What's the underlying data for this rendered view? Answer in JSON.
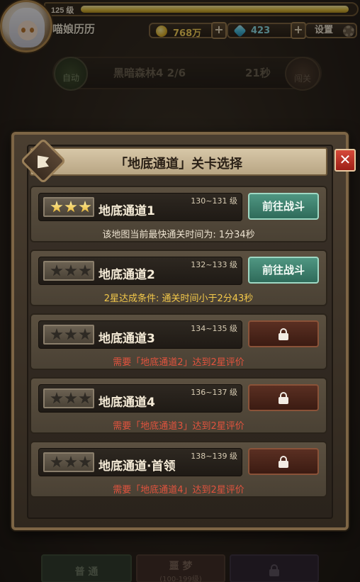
{
  "player": {
    "level": "125 级",
    "xp_fraction": 0.98,
    "name": "喵娘历历"
  },
  "resources": {
    "gold": "768万",
    "gems": "423",
    "plus": "+",
    "settings_label": "设置"
  },
  "stage_bar": {
    "auto_label": "自动",
    "stage": "黑暗森林4  2/6",
    "time": "21秒",
    "skip_label": "闯关"
  },
  "modal": {
    "title": "「地底通道」关卡选择",
    "close": "✕",
    "go_label": "前往战斗",
    "levels": [
      {
        "name": "地底通道1",
        "range": "130~131 级",
        "stars": 3,
        "locked": false,
        "note": "该地图当前最快通关时间为:  1分34秒",
        "note_type": "info"
      },
      {
        "name": "地底通道2",
        "range": "132~133 级",
        "stars": 0,
        "locked": false,
        "note": "2星达成条件: 通关时间小于2分43秒",
        "note_type": "cond"
      },
      {
        "name": "地底通道3",
        "range": "134~135 级",
        "stars": 0,
        "locked": true,
        "note": "需要「地底通道2」达到2星评价",
        "note_type": "req"
      },
      {
        "name": "地底通道4",
        "range": "136~137 级",
        "stars": 0,
        "locked": true,
        "note": "需要「地底通道3」达到2星评价",
        "note_type": "req"
      },
      {
        "name": "地底通道·首领",
        "range": "138~139 级",
        "stars": 0,
        "locked": true,
        "note": "需要「地底通道4」达到2星评价",
        "note_type": "req"
      }
    ]
  },
  "bottom_tabs": {
    "normal": "普 通",
    "nightmare": "噩 梦",
    "nightmare_sub": "(100-199级)"
  }
}
